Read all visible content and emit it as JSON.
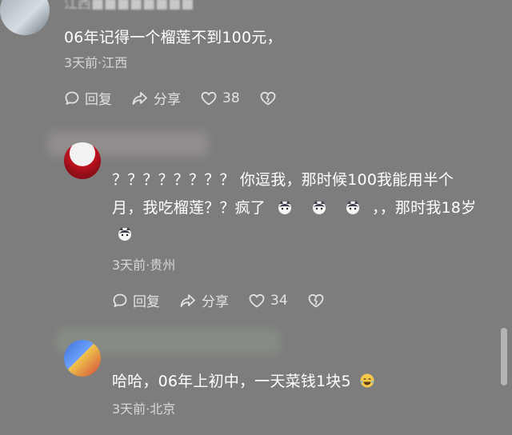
{
  "comment1": {
    "username": "江西■■■■■■■■",
    "text": "06年记得一个榴莲不到100元，",
    "meta": "3天前·江西",
    "reply_label": "回复",
    "share_label": "分享",
    "likes": "38"
  },
  "comment2": {
    "text_line1": "？？？？？？？？ 你逗我，那时候100我能用半个",
    "text_line2_a": "月，我吃榴莲？？疯了",
    "text_line2_b": "，，那时我18岁",
    "meta": "3天前·贵州",
    "reply_label": "回复",
    "share_label": "分享",
    "likes": "34"
  },
  "comment3": {
    "text": "哈哈，06年上初中，一天菜钱1块5",
    "meta": "3天前·北京"
  },
  "icons": {
    "reply": "comment-bubble-icon",
    "share": "share-arrow-icon",
    "like": "heart-icon",
    "dislike": "broken-heart-icon",
    "emoji_cat": "cat-emoji-icon",
    "emoji_laugh": "tears-of-joy-emoji-icon"
  }
}
